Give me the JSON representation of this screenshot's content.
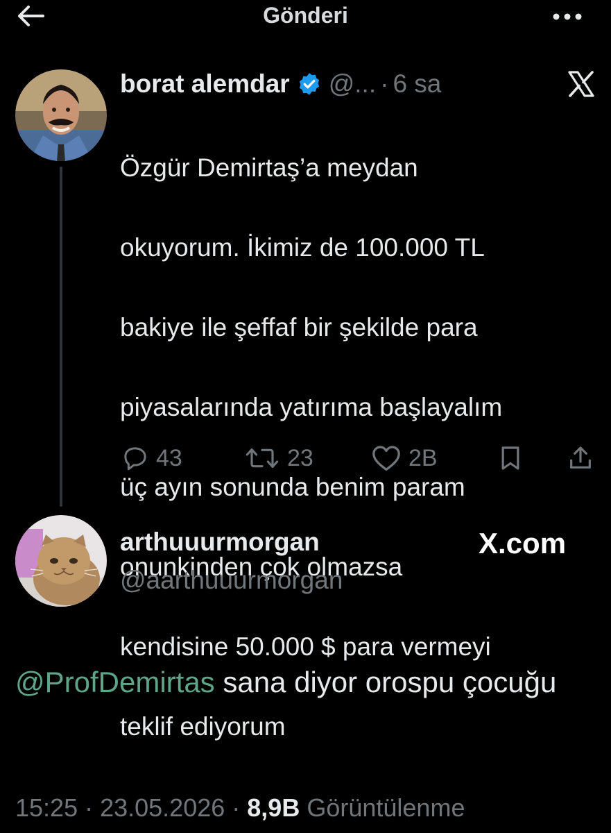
{
  "header": {
    "title": "Gönderi",
    "back_icon": "arrow-left-icon",
    "more_icon": "more-horizontal-icon"
  },
  "quoted_tweet": {
    "author_name": "borat alemdar",
    "verified_icon": "verified-badge-icon",
    "handle": "@...",
    "separator": "·",
    "time": "6 sa",
    "platform_icon": "x-logo-icon",
    "text_lines": [
      "Özgür Demirtaş’a meydan",
      "okuyorum. İkimiz de 100.000 TL",
      "bakiye ile şeffaf bir şekilde para",
      "piyasalarında yatırıma başlayalım",
      "üç ayın sonunda benim param",
      "onunkinden çok olmazsa",
      "kendisine 50.000 $ para vermeyi",
      "teklif ediyorum"
    ],
    "stats": {
      "replies": "43",
      "retweets": "23",
      "likes": "2B"
    }
  },
  "reply": {
    "author_name": "arthuuurmorgan",
    "handle": "@aarthuuurmorgan",
    "watermark": "X.com",
    "mention": "@ProfDemirtas",
    "text_after_mention": " sana diyor orospu çocuğu"
  },
  "meta": {
    "time": "15:25",
    "separator": " · ",
    "date": "23.05.2026",
    "views_count": "8,9B",
    "views_label": " Görüntülenme"
  },
  "colors": {
    "background": "#000000",
    "text_primary": "#e7e9ea",
    "text_secondary": "#71767b",
    "verified_blue": "#1d9bf0",
    "mention_green": "#5fa58a"
  }
}
